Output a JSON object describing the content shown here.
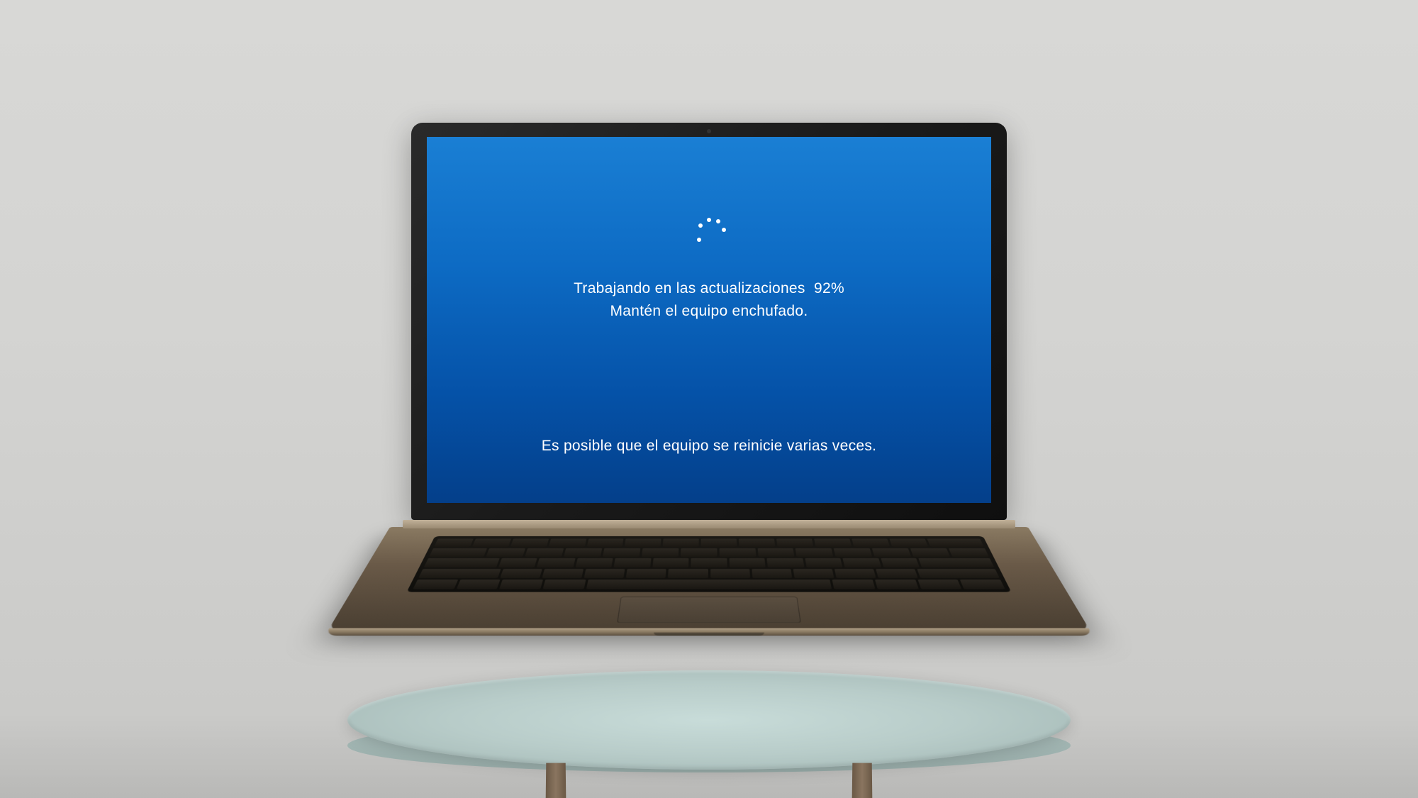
{
  "update_screen": {
    "progress_label": "Trabajando en las actualizaciones",
    "progress_percent": "92%",
    "instruction": "Mantén el equipo enchufado.",
    "restart_notice": "Es posible que el equipo se reinicie varias veces.",
    "colors": {
      "background_top": "#1a7fd4",
      "background_bottom": "#043f8a",
      "text": "#ffffff"
    }
  }
}
